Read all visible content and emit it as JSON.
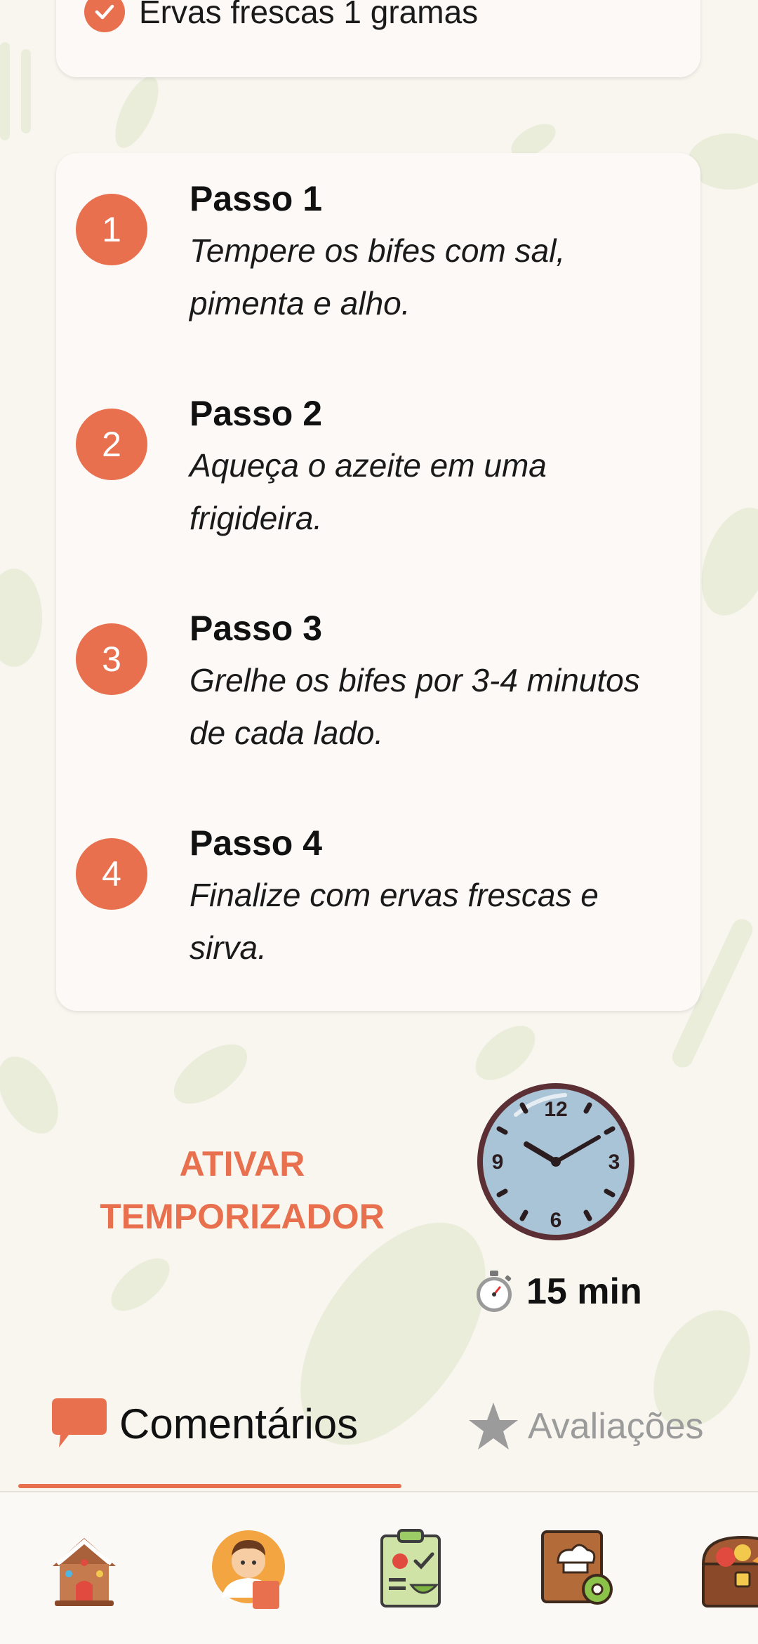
{
  "ingredients": {
    "last_item": "Ervas frescas 1 gramas"
  },
  "steps": [
    {
      "number": "1",
      "title": "Passo 1",
      "line1": "Tempere os bifes com sal,",
      "line2": "pimenta e alho."
    },
    {
      "number": "2",
      "title": "Passo 2",
      "line1": "Aqueça o azeite em uma",
      "line2": "frigideira."
    },
    {
      "number": "3",
      "title": "Passo 3",
      "line1": "Grelhe os bifes por 3-4 minutos",
      "line2": "de cada lado."
    },
    {
      "number": "4",
      "title": "Passo 4",
      "line1": "Finalize com ervas frescas e",
      "line2": "sirva."
    }
  ],
  "timer": {
    "button_line1": "ATIVAR",
    "button_line2": "TEMPORIZADOR",
    "duration": "15 min",
    "clock_numbers": {
      "twelve": "12",
      "three": "3",
      "six": "6",
      "nine": "9"
    }
  },
  "tabs": [
    {
      "label": "Comentários",
      "active": true
    },
    {
      "label": "Avaliações",
      "active": false
    }
  ],
  "bottom_nav": [
    {
      "icon": "gingerbread-house-icon"
    },
    {
      "icon": "chef-avatar-icon"
    },
    {
      "icon": "meal-checklist-icon"
    },
    {
      "icon": "recipe-book-settings-icon"
    },
    {
      "icon": "treasure-chest-food-icon"
    }
  ],
  "colors": {
    "accent": "#e8704e",
    "background": "#f8f6ef",
    "card": "#fcf9f6",
    "inactive_tab": "#9b9b9b"
  }
}
